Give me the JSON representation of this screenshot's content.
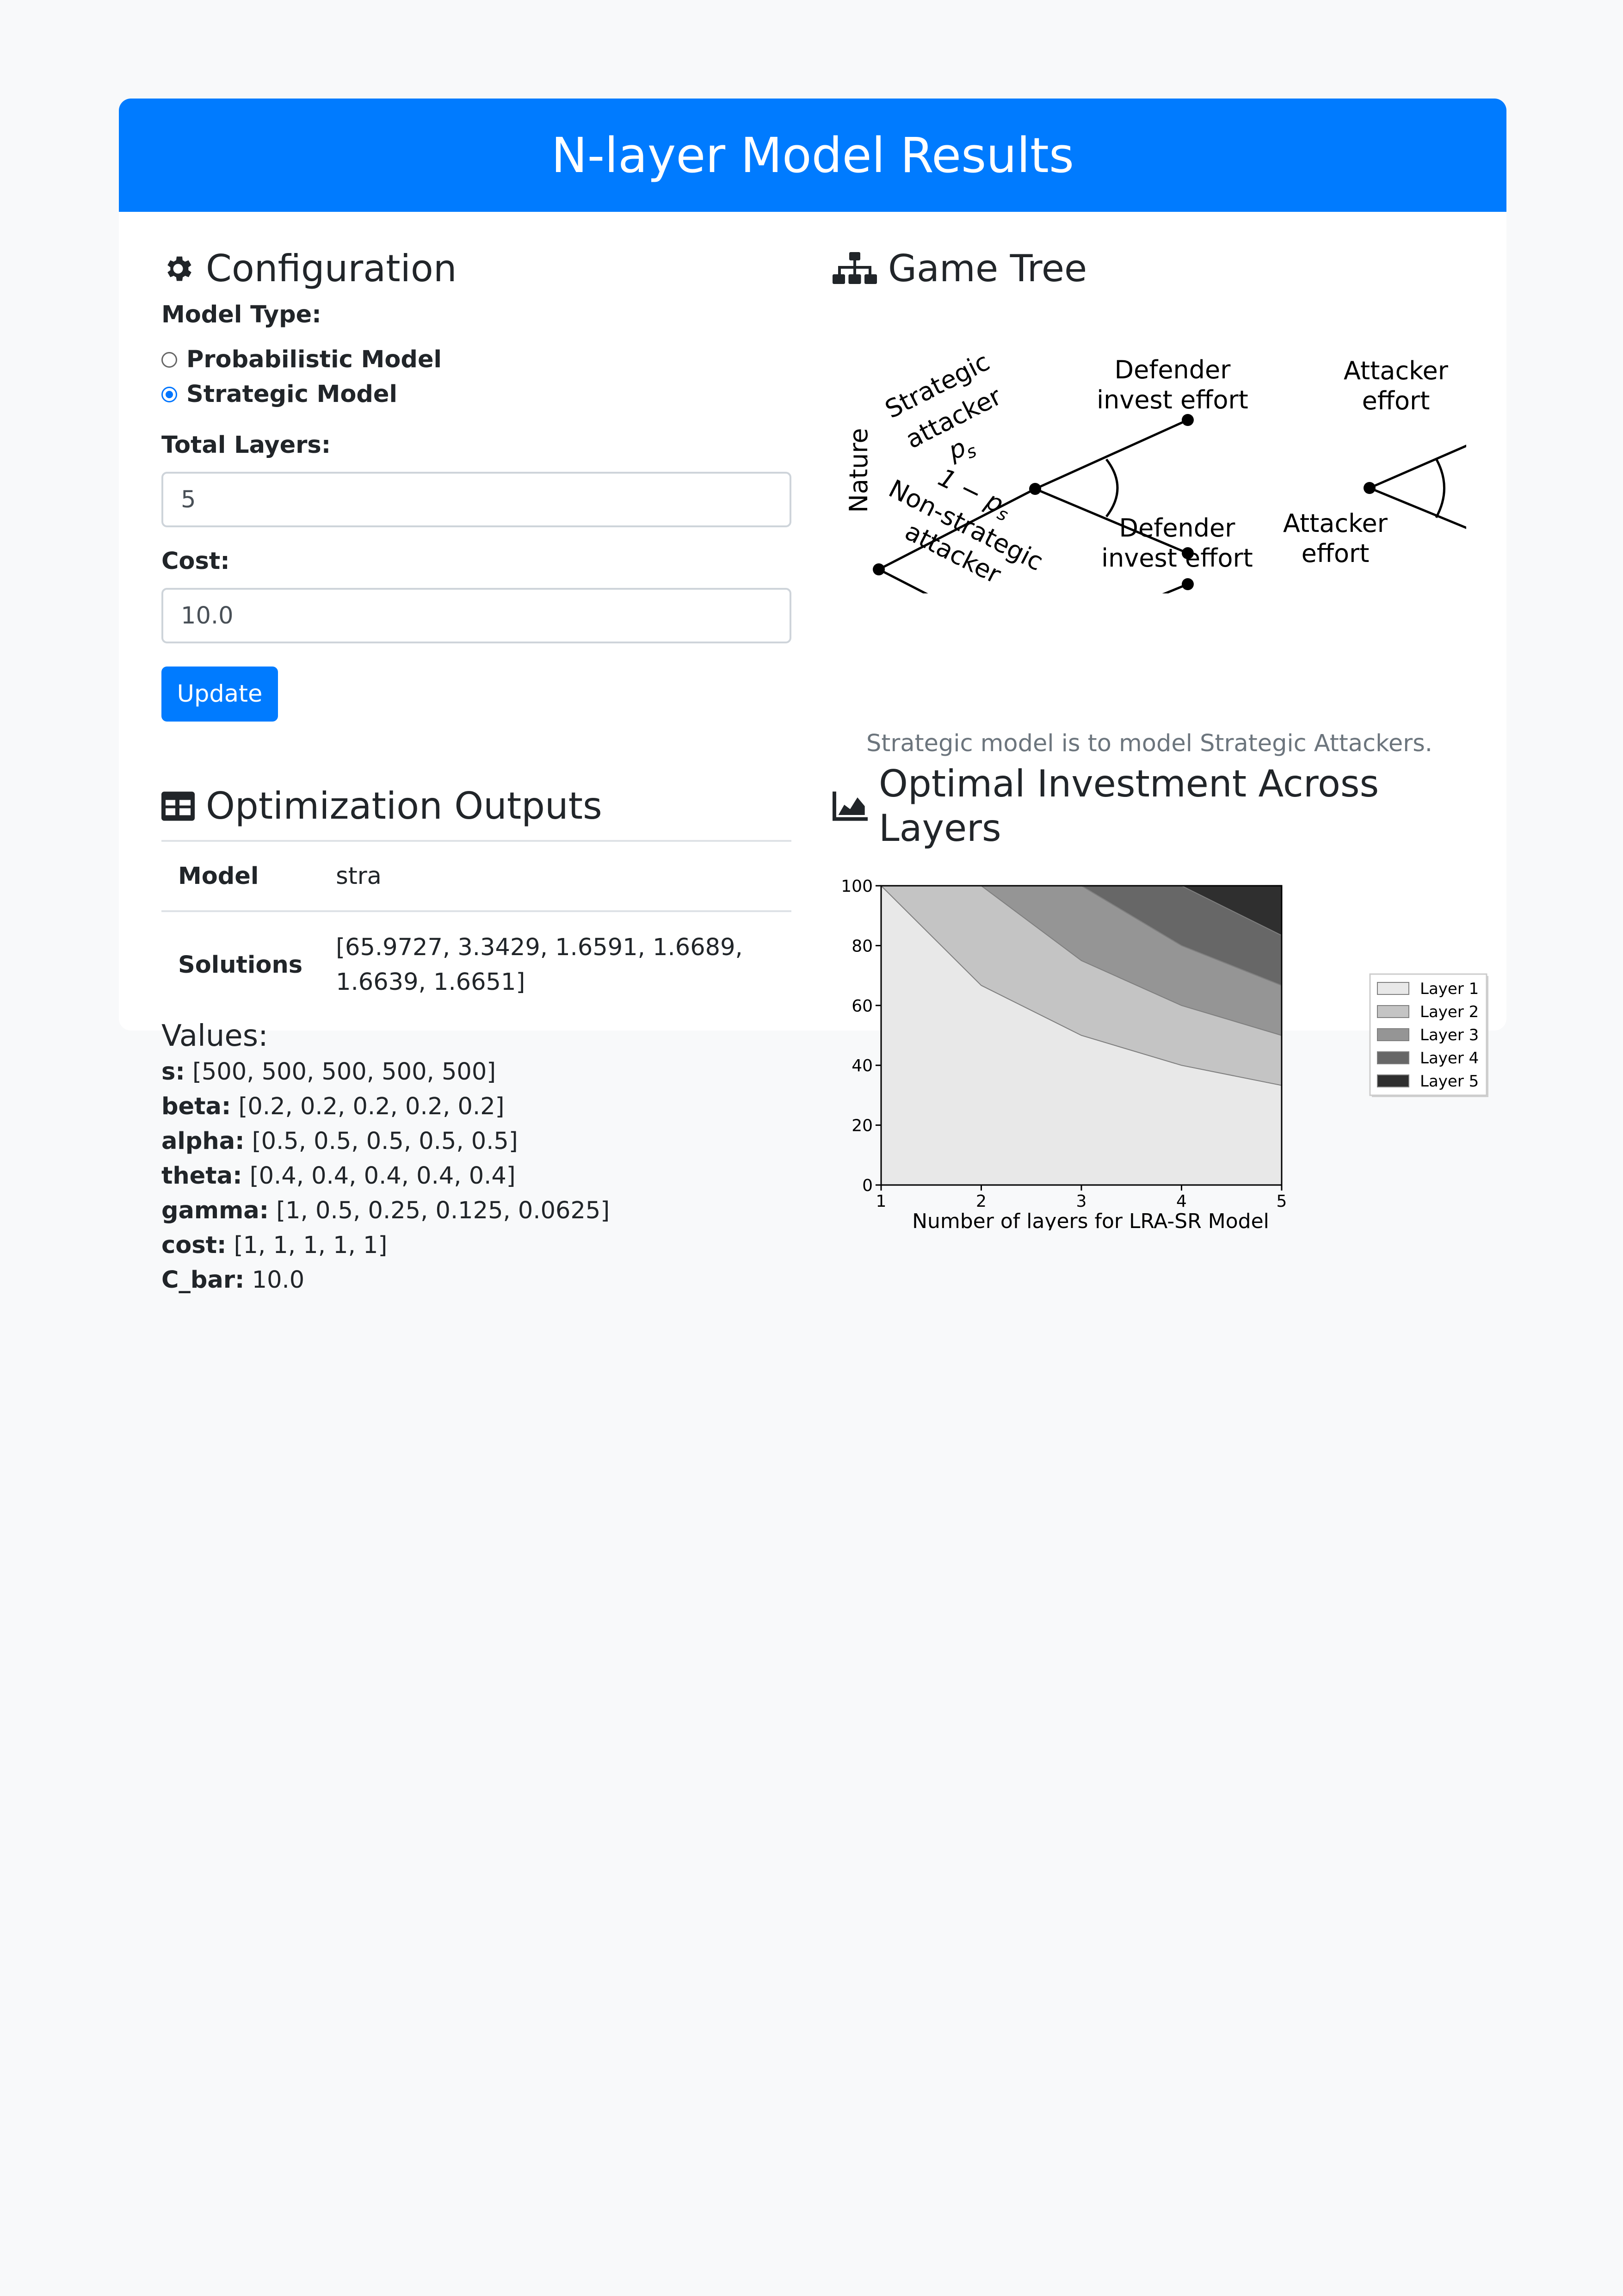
{
  "header": {
    "title": "N-layer Model Results"
  },
  "config": {
    "title": "Configuration",
    "model_type_label": "Model Type:",
    "options": [
      "Probabilistic Model",
      "Strategic Model"
    ],
    "selected": "Strategic Model",
    "total_layers_label": "Total Layers:",
    "total_layers_value": "5",
    "cost_label": "Cost:",
    "cost_value": "10.0",
    "update_label": "Update"
  },
  "game_tree": {
    "title": "Game Tree",
    "caption": "Strategic model is to model Strategic Attackers.",
    "labels": {
      "nature": "Nature",
      "strategic": "Strategic",
      "attacker": "attacker",
      "ps": "p_s",
      "one_minus_ps": "1 − p_s",
      "non_strategic": "Non-strategic",
      "defender": "Defender",
      "invest_effort": "invest effort",
      "attacker_cap": "Attacker",
      "effort": "effort"
    }
  },
  "outputs": {
    "title": "Optimization Outputs",
    "rows": [
      {
        "key": "Model",
        "value": "stra"
      },
      {
        "key": "Solutions",
        "value": "[65.9727, 3.3429, 1.6591, 1.6689, 1.6639, 1.6651]"
      }
    ],
    "values_title": "Values:",
    "values": [
      {
        "key": "s:",
        "value": "[500, 500, 500, 500, 500]"
      },
      {
        "key": "beta:",
        "value": "[0.2, 0.2, 0.2, 0.2, 0.2]"
      },
      {
        "key": "alpha:",
        "value": "[0.5, 0.5, 0.5, 0.5, 0.5]"
      },
      {
        "key": "theta:",
        "value": "[0.4, 0.4, 0.4, 0.4, 0.4]"
      },
      {
        "key": "gamma:",
        "value": "[1, 0.5, 0.25, 0.125, 0.0625]"
      },
      {
        "key": "cost:",
        "value": "[1, 1, 1, 1, 1]"
      },
      {
        "key": "C_bar:",
        "value": "10.0"
      }
    ]
  },
  "investment": {
    "title": "Optimal Investment Across Layers"
  },
  "chart_data": {
    "type": "area",
    "x": [
      1,
      2,
      3,
      4,
      5
    ],
    "xlabel": "Number of layers for LRA-SR Model",
    "ylabel": "",
    "xlim": [
      1,
      5
    ],
    "ylim": [
      0,
      100
    ],
    "xticks": [
      1,
      2,
      3,
      4,
      5
    ],
    "yticks": [
      0,
      20,
      40,
      60,
      80,
      100
    ],
    "stacked": true,
    "legend_position": "right",
    "series": [
      {
        "name": "Layer 1",
        "color": "#e8e8e8",
        "values": [
          100,
          66.7,
          50,
          40,
          33.3
        ]
      },
      {
        "name": "Layer 2",
        "color": "#c4c4c4",
        "values": [
          0,
          33.3,
          25,
          20,
          16.7
        ]
      },
      {
        "name": "Layer 3",
        "color": "#959595",
        "values": [
          0,
          0,
          25,
          20,
          16.7
        ]
      },
      {
        "name": "Layer 4",
        "color": "#676767",
        "values": [
          0,
          0,
          0,
          20,
          16.7
        ]
      },
      {
        "name": "Layer 5",
        "color": "#2f2f2f",
        "values": [
          0,
          0,
          0,
          0,
          16.7
        ]
      }
    ]
  }
}
